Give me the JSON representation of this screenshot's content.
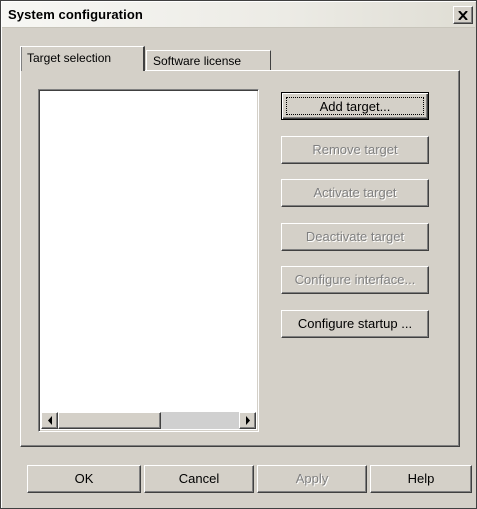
{
  "window": {
    "title": "System configuration",
    "close_glyph": "✕"
  },
  "tabs": [
    {
      "label": "Target selection",
      "active": true
    },
    {
      "label": "Software license",
      "active": false
    }
  ],
  "target_list": {
    "items": [],
    "scroll_left_glyph": "◀",
    "scroll_right_glyph": "▶"
  },
  "actions": {
    "add_target": "Add target...",
    "remove_target": "Remove target",
    "activate_target": "Activate target",
    "deactivate_target": "Deactivate target",
    "configure_interface": "Configure interface...",
    "configure_startup": "Configure startup ..."
  },
  "footer": {
    "ok": "OK",
    "cancel": "Cancel",
    "apply": "Apply",
    "help": "Help"
  },
  "colors": {
    "dialog_face": "#d4d0c8",
    "disabled_text": "#808080",
    "highlight": "#ffffff",
    "shadow": "#404040"
  }
}
